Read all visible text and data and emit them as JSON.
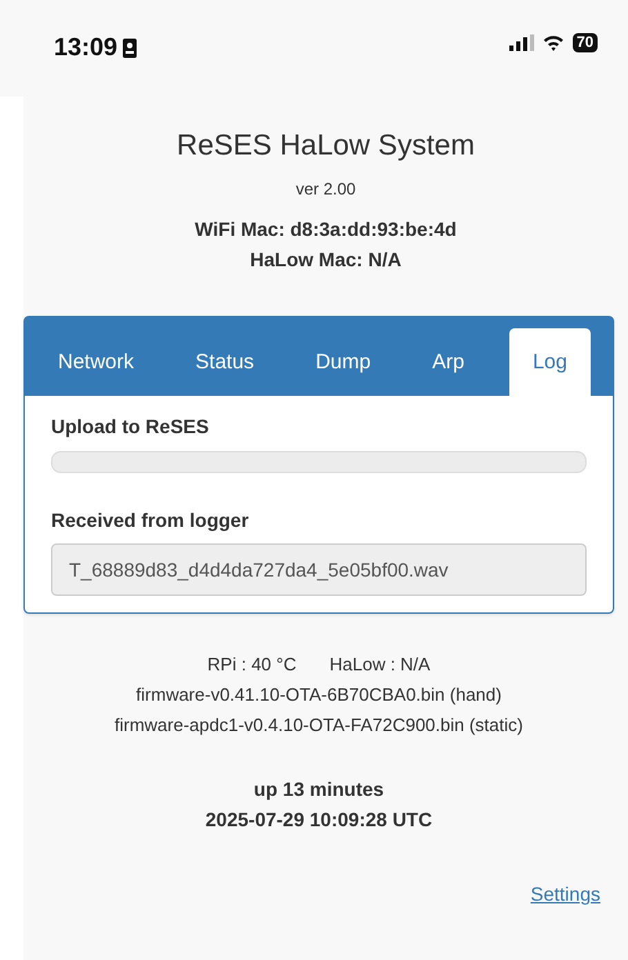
{
  "status_bar": {
    "time": "13:09",
    "battery": "70"
  },
  "header": {
    "title": "ReSES HaLow System",
    "version": "ver 2.00",
    "wifi_mac": "WiFi Mac: d8:3a:dd:93:be:4d",
    "halow_mac": "HaLow Mac: N/A"
  },
  "tabs": [
    {
      "label": "Network",
      "selected": false
    },
    {
      "label": "Status",
      "selected": false
    },
    {
      "label": "Dump",
      "selected": false
    },
    {
      "label": "Arp",
      "selected": false
    },
    {
      "label": "Log",
      "selected": true
    }
  ],
  "log": {
    "upload_label": "Upload to ReSES",
    "received_label": "Received from logger",
    "received_file": "T_68889d83_d4d4da727da4_5e05bf00.wav"
  },
  "footer": {
    "temps": [
      "RPi : 40 °C",
      "HaLow : N/A"
    ],
    "firmware": [
      "firmware-v0.41.10-OTA-6B70CBA0.bin (hand)",
      "firmware-apdc1-v0.4.10-OTA-FA72C900.bin (static)"
    ],
    "uptime": "up 13 minutes",
    "timestamp": "2025-07-29 10:09:28 UTC",
    "settings_link": "Settings"
  }
}
